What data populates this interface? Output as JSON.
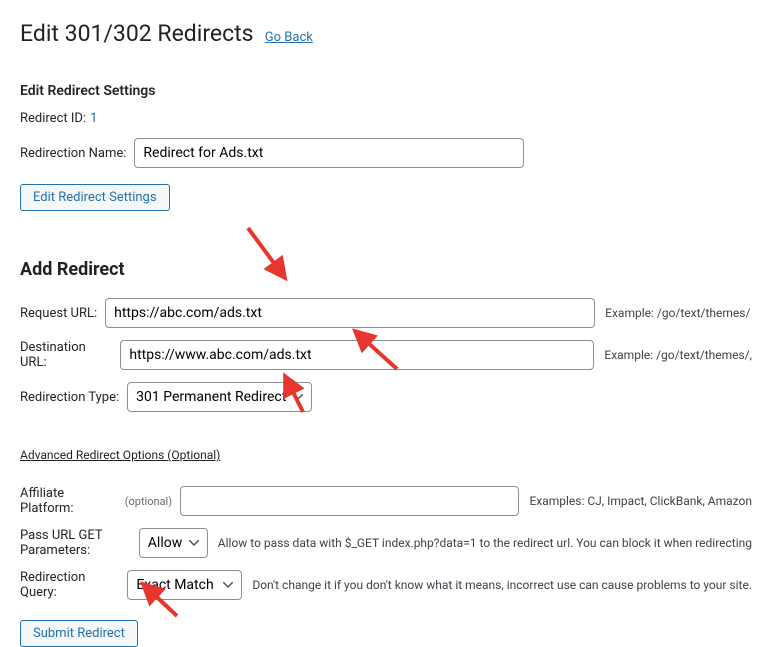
{
  "header": {
    "title": "Edit 301/302 Redirects",
    "go_back": "Go Back"
  },
  "edit_settings": {
    "heading": "Edit Redirect Settings",
    "id_label": "Redirect ID:",
    "id_value": "1",
    "name_label": "Redirection Name:",
    "name_value": "Redirect for Ads.txt",
    "button": "Edit Redirect Settings"
  },
  "add_redirect": {
    "heading": "Add Redirect",
    "request_url_label": "Request URL:",
    "request_url_value": "https://abc.com/ads.txt",
    "request_url_hint": "Example: /go/text/themes/",
    "destination_url_label": "Destination URL:",
    "destination_url_value": "https://www.abc.com/ads.txt",
    "destination_url_hint": "Example: /go/text/themes/,",
    "redirection_type_label": "Redirection Type:",
    "redirection_type_value": "301 Permanent Redirect",
    "adv_link": "Advanced Redirect Options (Optional)",
    "affiliate_label": "Affiliate Platform:",
    "affiliate_optional": "(optional)",
    "affiliate_hint": "Examples: CJ, Impact, ClickBank, Amazon",
    "pass_get_label": "Pass URL GET Parameters:",
    "pass_get_value": "Allow",
    "pass_get_hint": "Allow to pass data with $_GET index.php?data=1 to the redirect url. You can block it when redirecting",
    "query_label": "Redirection Query:",
    "query_value": "Exact Match",
    "query_hint": "Don't change it if you don't know what it means, incorrect use can cause problems to your site.",
    "submit_button": "Submit Redirect"
  }
}
